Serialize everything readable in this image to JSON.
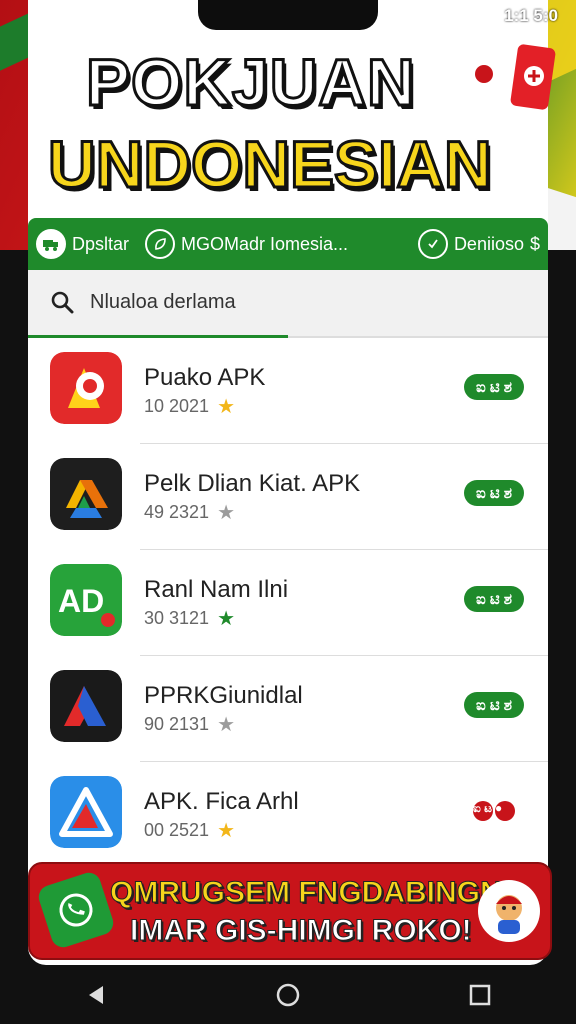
{
  "status": {
    "time": "1:1 5:0"
  },
  "banner": {
    "title_line1": "POKJUAN",
    "title_line2": "UNDONESIAN"
  },
  "filters": {
    "left_label": "Dpsltar",
    "mid_label": "MGOMadr Iomesia...",
    "right_label": "Deniioso",
    "right_suffix": "$"
  },
  "search": {
    "placeholder": "Nlualoa derlama"
  },
  "apps": [
    {
      "name": "Puako APK",
      "meta": "10 2021",
      "star": "gold",
      "action": "ಐ ಟಿ ಶ"
    },
    {
      "name": "Pelk Dlian Kiat. APK",
      "meta": "49 2321",
      "star": "grey",
      "action": "ಐ ಟಿ ಶ"
    },
    {
      "name": "Ranl Nam Ilni",
      "meta": "30 3121",
      "star": "green",
      "action": "ಐ ಟಿ ಶ"
    },
    {
      "name": "PPRKGiunidlal",
      "meta": "90 2131",
      "star": "grey",
      "action": "ಐ ಟಿ ಶ"
    },
    {
      "name": "APK. Fica Arhl",
      "meta": "00 2521",
      "star": "gold",
      "action": "ಐ ಟ"
    }
  ],
  "promo": {
    "line1": "QMRUGSEM FNGDABINGN",
    "line2": "IMAR GIS-HIMGI ROKO!"
  },
  "colors": {
    "primary_green": "#1f8a2b",
    "brand_red": "#c8141a",
    "accent_yellow": "#f6d51c"
  }
}
